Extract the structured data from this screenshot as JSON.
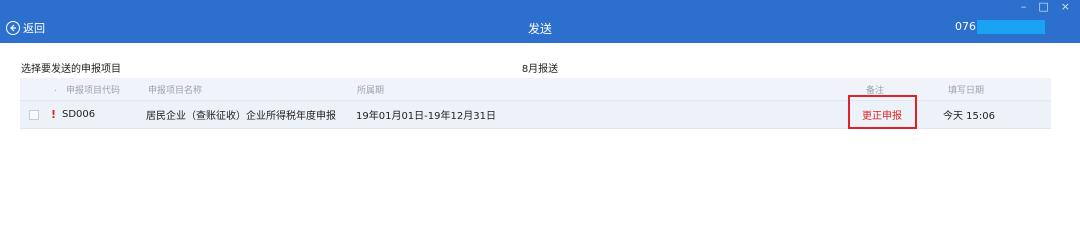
{
  "window": {
    "title": "发送",
    "back_label": "返回",
    "user_id": "076",
    "controls": {
      "minimize": "–",
      "maximize": "□",
      "close": "×"
    }
  },
  "main": {
    "section_label": "选择要发送的申报项目",
    "period_label": "8月报送",
    "table": {
      "headers": {
        "dot": ".",
        "code": "申报项目代码",
        "name": "申报项目名称",
        "period": "所属期",
        "remark": "备注",
        "date": "填写日期"
      },
      "rows": [
        {
          "warning": "!",
          "code": "SD006",
          "name": "居民企业（查账征收）企业所得税年度申报",
          "period": "19年01月01日-19年12月31日",
          "remark": "更正申报",
          "date": "今天 15:06"
        }
      ]
    }
  },
  "colors": {
    "titlebar": "#2c6fcd",
    "warning": "#e02424",
    "highlight": "#e0202a",
    "row_bg": "#edf2f9"
  }
}
